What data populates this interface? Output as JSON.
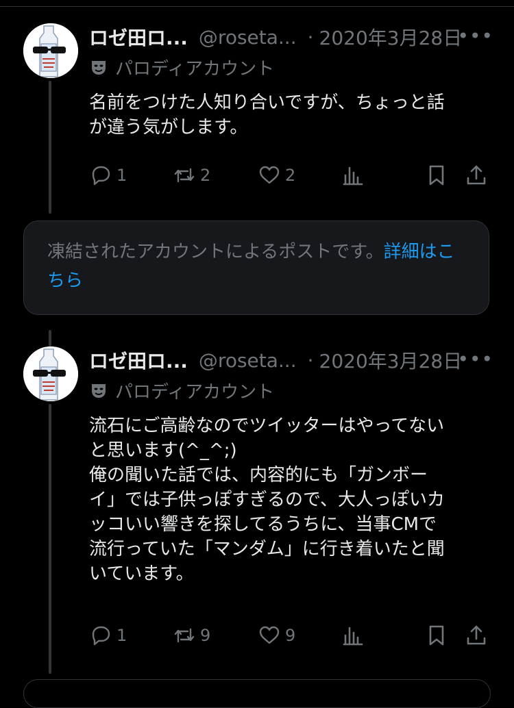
{
  "posts": [
    {
      "name": "ロゼ田ロ...",
      "handle": "@roseta...",
      "dot": "·",
      "date": "2020年3月28日",
      "more": "•••",
      "parody_icon": "theater-mask-icon",
      "parody_label": "パロディアカウント",
      "text": "名前をつけた人知り合いですが、ちょっと話\nが違う気がします。",
      "actions": {
        "replies": "1",
        "reposts": "2",
        "likes": "2"
      }
    },
    {
      "name": "ロゼ田ロ...",
      "handle": "@roseta...",
      "dot": "·",
      "date": "2020年3月28日",
      "more": "•••",
      "parody_icon": "theater-mask-icon",
      "parody_label": "パロディアカウント",
      "text": "流石にご高齢なのでツイッターはやってない\nと思います(^_^;)\n俺の聞いた話では、内容的にも「ガンボー\nイ」では子供っぽすぎるので、大人っぽいカ\nッコいい響きを探してるうちに、当事CMで\n流行っていた「マンダム」に行き着いたと聞\nいています。",
      "actions": {
        "replies": "1",
        "reposts": "9",
        "likes": "9"
      }
    }
  ],
  "notice": {
    "text": "凍結されたアカウントによるポストです。",
    "link": "詳細はこちら"
  },
  "colors": {
    "background": "#000000",
    "text": "#e7e9ea",
    "muted": "#71767b",
    "link": "#1d9bf0"
  }
}
